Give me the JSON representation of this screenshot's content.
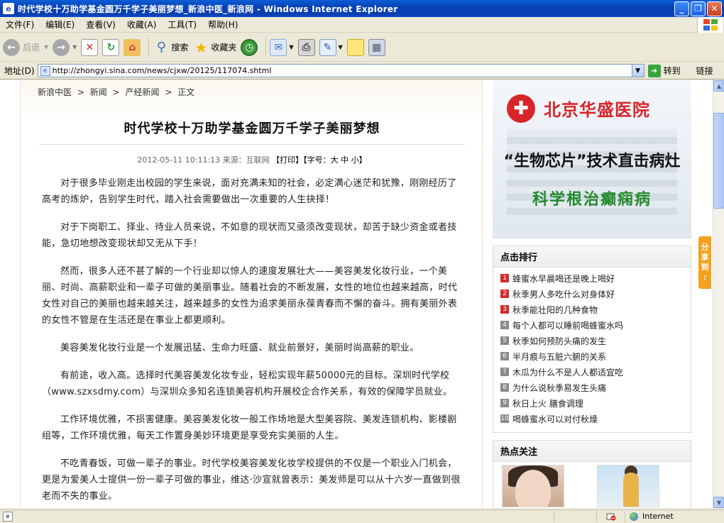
{
  "window": {
    "title": "时代学校十万助学基金圆万千学子美丽梦想_新浪中医_新浪网 - Windows Internet Explorer",
    "min": "_",
    "max": "❐",
    "close": "✕"
  },
  "menu": [
    "文件(F)",
    "编辑(E)",
    "查看(V)",
    "收藏(A)",
    "工具(T)",
    "帮助(H)"
  ],
  "toolbar": {
    "back": "后退",
    "search": "搜索",
    "favorites": "收藏夹"
  },
  "address": {
    "label": "地址(D)",
    "url": "http://zhongyi.sina.com/news/cjxw/20125/117074.shtml",
    "go": "转到",
    "links": "链接"
  },
  "breadcrumb": [
    "新浪中医",
    ">",
    "新闻",
    ">",
    "产经新闻",
    ">",
    "正文"
  ],
  "article": {
    "title": "时代学校十万助学基金圆万千学子美丽梦想",
    "meta": "2012-05-11  10:11:13  来源：互联网",
    "print": "【打印】",
    "fontsize": "【字号：大  中  小】",
    "paragraphs": [
      "对于很多毕业刚走出校园的学生来说，面对充满未知的社会，必定满心迷茫和犹豫，刚刚经历了高考的炼炉，告别学生时代，踏入社会需要做出一次重要的人生抉择！",
      "对于下岗职工、择业、待业人员来说，不如意的现状而又亟须改变现状，却苦于缺少资金或者技能，急切地想改变现状却又无从下手！",
      "然而，很多人还不甚了解的一个行业却以惊人的速度发展壮大——美容美发化妆行业，一个美丽、时尚、高薪职业和一辈子可做的美丽事业。随着社会的不断发展，女性的地位也越来越高，时代女性对自己的美丽也越来越关注，越来越多的女性为追求美丽永葆青春而不懈的奋斗。拥有美丽外表的女性不管是在生活还是在事业上都更顺利。",
      "美容美发化妆行业是一个发展迅猛、生命力旺盛、就业前景好，美丽时尚高薪的职业。",
      "有前途，收入高。选择时代美容美发化妆专业，轻松实现年薪50000元的目标。深圳时代学校（www.szxsdmy.com）与深圳众多知名连锁美容机构开展校企合作关系，有效的保障学员就业。",
      "工作环境优雅，不损害健康。美容美发化妆一般工作场地是大型美容院、美发连锁机构、影楼剧组等，工作环境优雅，每天工作置身美妙环境更是享受充实美丽的人生。",
      "不吃青春饭，可做一辈子的事业。时代学校美容美发化妆学校提供的不仅是一个职业入门机会，更是为爱美人士提供一份一辈子可做的事业，维达·沙宣就曾表示：美发师是可以从十六岁一直做到很老而不失的事业。"
    ]
  },
  "ad": {
    "hospital": "北京华盛医院",
    "line1": "“生物芯片”技术直击病灶",
    "line2": "科学根治癫痫病"
  },
  "ranking": {
    "title": "点击排行",
    "items": [
      {
        "n": "1",
        "text": "蜂蜜水早晨喝还是晚上喝好"
      },
      {
        "n": "2",
        "text": "秋季男人多吃什么对身体好"
      },
      {
        "n": "3",
        "text": "秋季能壮阳的几种食物"
      },
      {
        "n": "4",
        "text": "每个人都可以睡前喝蜂蜜水吗"
      },
      {
        "n": "5",
        "text": "秋季如何预防头痛的发生"
      },
      {
        "n": "6",
        "text": "半月痕与五脏六腑的关系"
      },
      {
        "n": "7",
        "text": "木瓜为什么不是人人都适宜吃"
      },
      {
        "n": "8",
        "text": "为什么说秋季易发生头痛"
      },
      {
        "n": "9",
        "text": "秋日上火  膳食调理"
      },
      {
        "n": "10",
        "text": "喝蜂蜜水可以对付秋燥"
      }
    ]
  },
  "hot": {
    "title": "热点关注"
  },
  "share": [
    "分",
    "享",
    "到"
  ],
  "status": {
    "zone": "Internet"
  }
}
